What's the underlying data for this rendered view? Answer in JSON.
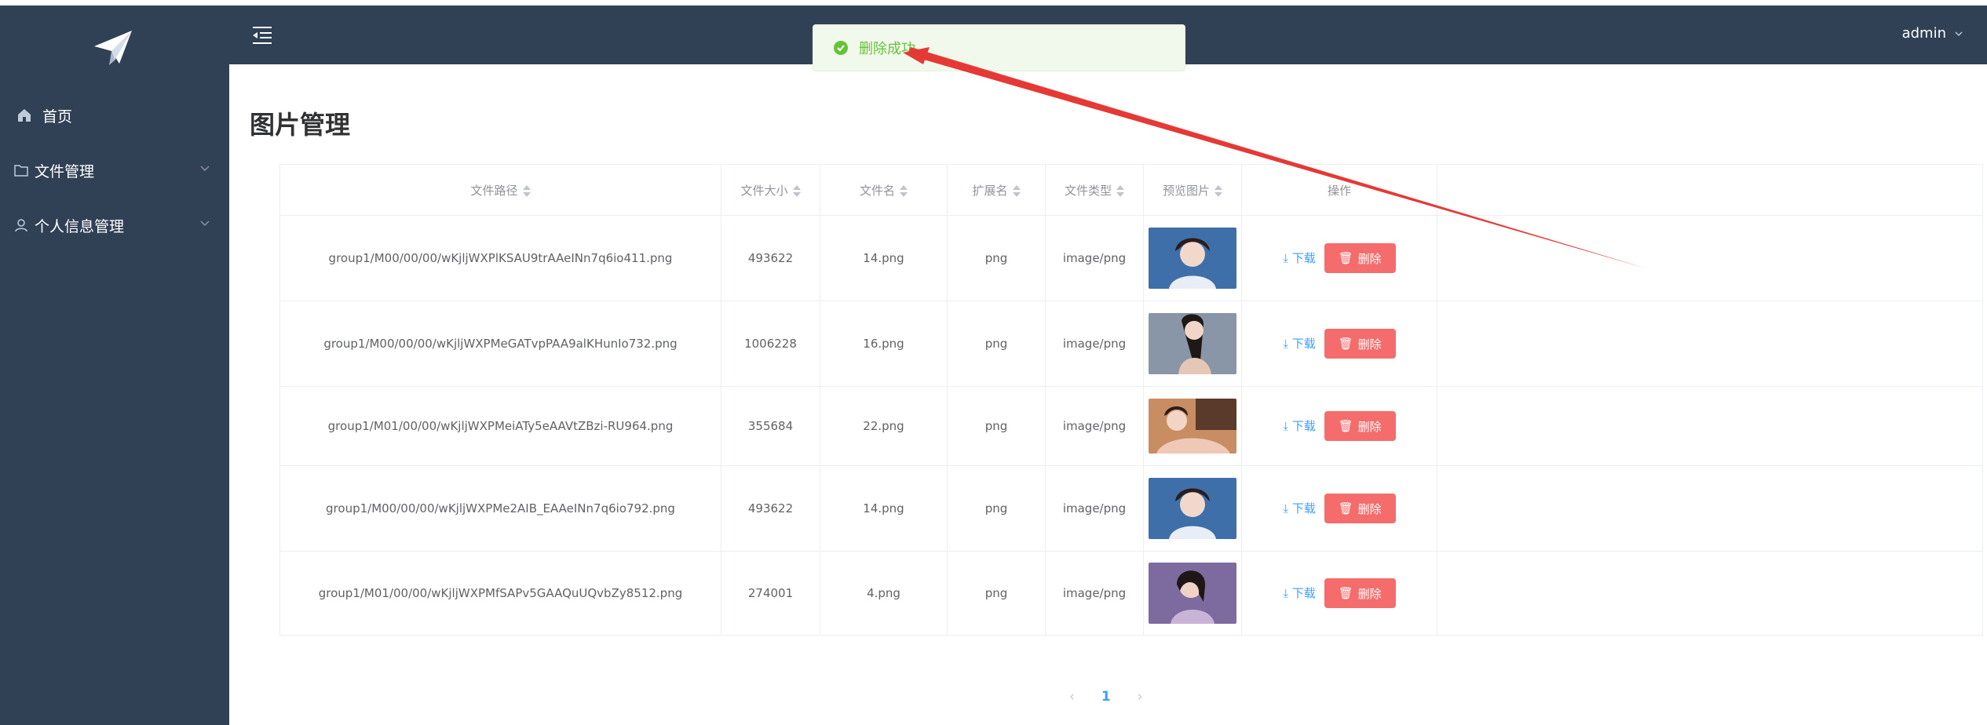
{
  "header": {
    "user": "admin"
  },
  "sidebar": {
    "items": [
      {
        "label": "首页",
        "icon": "home-icon"
      },
      {
        "label": "文件管理",
        "icon": "folder-icon"
      },
      {
        "label": "个人信息管理",
        "icon": "user-icon"
      }
    ]
  },
  "toast": {
    "message": "删除成功"
  },
  "page": {
    "title": "图片管理"
  },
  "table": {
    "columns": [
      "文件路径",
      "文件大小",
      "文件名",
      "扩展名",
      "文件类型",
      "预览图片",
      "操作"
    ],
    "download_label": "下载",
    "delete_label": "删除",
    "rows": [
      {
        "path": "group1/M00/00/00/wKjljWXPlKSAU9trAAeINn7q6io411.png",
        "size": "493622",
        "name": "14.png",
        "ext": "png",
        "type": "image/png"
      },
      {
        "path": "group1/M00/00/00/wKjljWXPMeGATvpPAA9alKHunIo732.png",
        "size": "1006228",
        "name": "16.png",
        "ext": "png",
        "type": "image/png"
      },
      {
        "path": "group1/M01/00/00/wKjljWXPMeiATy5eAAVtZBzi-RU964.png",
        "size": "355684",
        "name": "22.png",
        "ext": "png",
        "type": "image/png"
      },
      {
        "path": "group1/M00/00/00/wKjljWXPMe2AIB_EAAeINn7q6io792.png",
        "size": "493622",
        "name": "14.png",
        "ext": "png",
        "type": "image/png"
      },
      {
        "path": "group1/M01/00/00/wKjljWXPMfSAPv5GAAQuUQvbZy8512.png",
        "size": "274001",
        "name": "4.png",
        "ext": "png",
        "type": "image/png"
      }
    ]
  },
  "pagination": {
    "current": "1",
    "prev": "‹",
    "next": "›"
  },
  "colors": {
    "sidebar_bg": "#304156",
    "primary": "#409eff",
    "danger": "#f56c6c",
    "success": "#67c23a",
    "annotation_arrow": "#e53935"
  }
}
